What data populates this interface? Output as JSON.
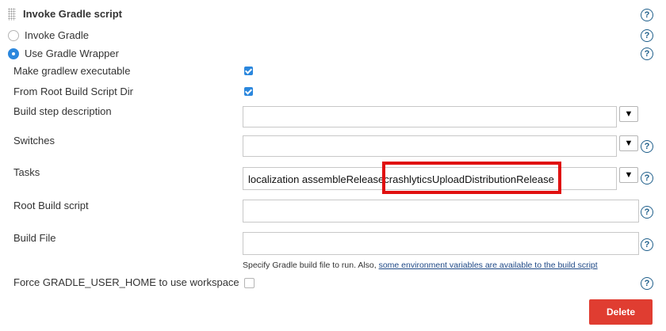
{
  "section": {
    "title": "Invoke Gradle script",
    "help_glyph": "?"
  },
  "options": {
    "invoke_gradle": {
      "label": "Invoke Gradle",
      "selected": false
    },
    "use_wrapper": {
      "label": "Use Gradle Wrapper",
      "selected": true
    }
  },
  "checks": {
    "make_executable": {
      "label": "Make gradlew executable",
      "checked": true
    },
    "from_root": {
      "label": "From Root Build Script Dir",
      "checked": true
    },
    "force_home": {
      "label": "Force GRADLE_USER_HOME to use workspace",
      "checked": false
    }
  },
  "fields": {
    "build_step_description": {
      "label": "Build step description",
      "value": ""
    },
    "switches": {
      "label": "Switches",
      "value": ""
    },
    "tasks": {
      "label": "Tasks",
      "value_part1": "localization assembleRelease",
      "value_part2": "crashlyticsUploadDistributionRelease"
    },
    "root_build_script": {
      "label": "Root Build script",
      "value": ""
    },
    "build_file": {
      "label": "Build File",
      "value": "",
      "hint": "Specify Gradle build file to run. Also,",
      "hint_link": "some environment variables are available to the build script"
    }
  },
  "dropdown_glyph": "▼",
  "delete_button": {
    "label": "Delete",
    "color": "#e03d31"
  },
  "highlight_color": "#e01010"
}
